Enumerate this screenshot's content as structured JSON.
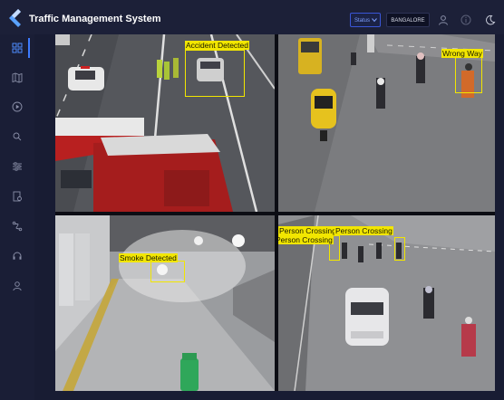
{
  "app": {
    "title": "Traffic Management System",
    "accent": "#3d7bff",
    "detection_color": "#f2e600"
  },
  "header": {
    "status_select": {
      "value": "Status"
    },
    "city_button": {
      "label": "BANGALORE"
    },
    "icons": [
      "user-icon",
      "info-icon",
      "theme-toggle-icon"
    ]
  },
  "sidebar": {
    "items": [
      {
        "icon": "dashboard-icon",
        "active": true
      },
      {
        "icon": "map-icon"
      },
      {
        "icon": "play-icon"
      },
      {
        "icon": "search-icon"
      },
      {
        "icon": "settings-sliders-icon"
      },
      {
        "icon": "report-icon"
      },
      {
        "icon": "route-icon"
      },
      {
        "icon": "headset-icon"
      },
      {
        "icon": "profile-icon"
      }
    ]
  },
  "cameras": [
    {
      "detections": [
        {
          "label": "Accident Detected"
        }
      ]
    },
    {
      "detections": [
        {
          "label": "Wrong Way"
        }
      ]
    },
    {
      "detections": [
        {
          "label": "Smoke Detected"
        }
      ]
    },
    {
      "detections": [
        {
          "label": "Person Crossing"
        },
        {
          "label": "Person Crossing"
        },
        {
          "label": "Person Crossing"
        }
      ]
    }
  ]
}
